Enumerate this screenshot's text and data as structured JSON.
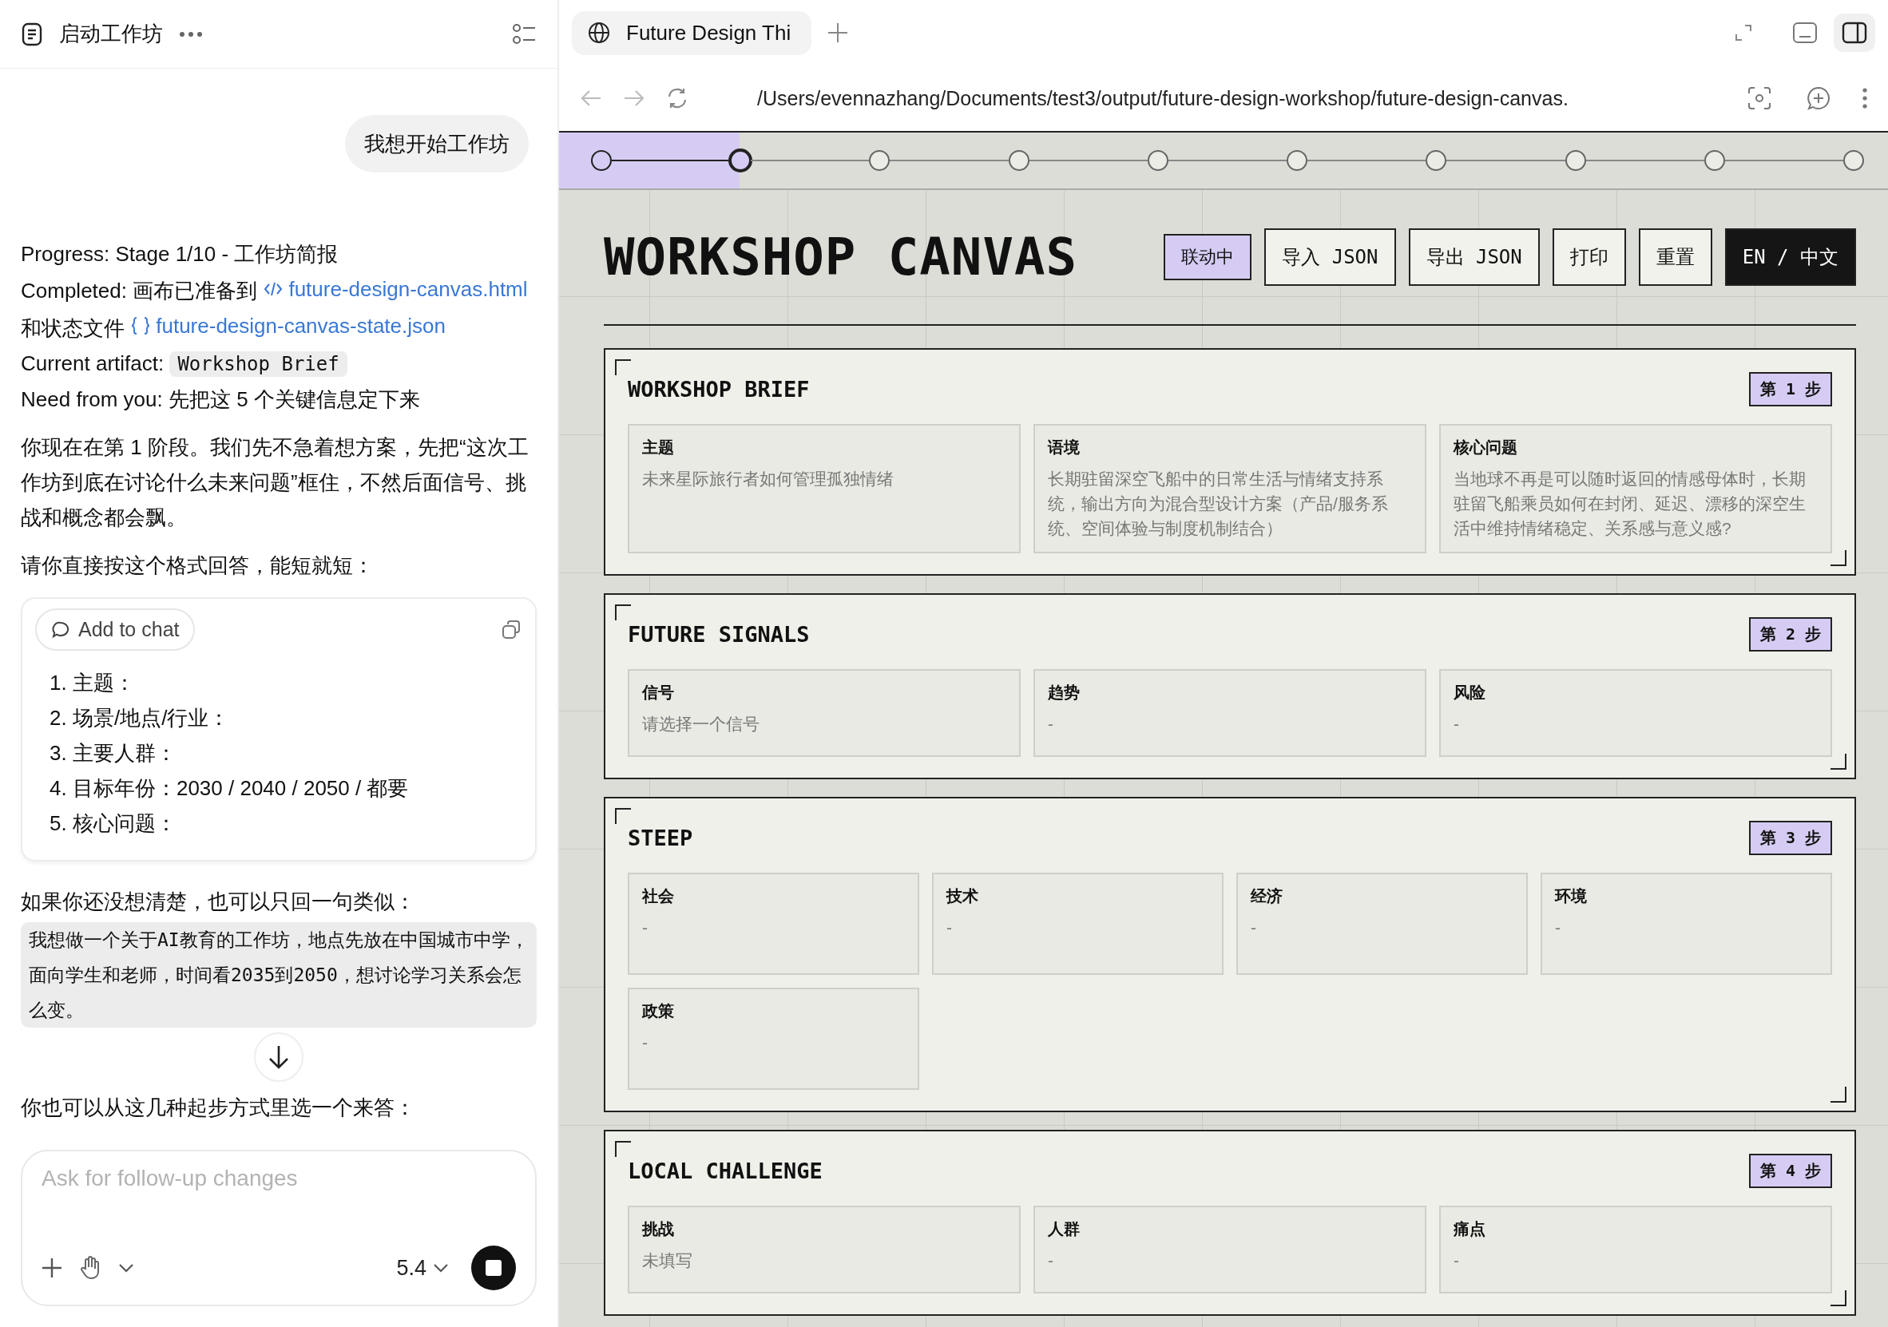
{
  "chat": {
    "title": "启动工作坊",
    "user_message": "我想开始工作坊",
    "status_lines": [
      [
        {
          "kind": "text",
          "text": "Progress: Stage 1/10 - 工作坊简报"
        }
      ],
      [
        {
          "kind": "text",
          "text": "Completed: 画布已准备到 "
        },
        {
          "kind": "link",
          "text": "future-design-canvas.html"
        },
        {
          "kind": "text",
          "text": " 和状态文件 "
        },
        {
          "kind": "link",
          "text": "future-design-canvas-state.json"
        }
      ],
      [
        {
          "kind": "text",
          "text": "Current artifact: "
        },
        {
          "kind": "code",
          "text": "Workshop Brief"
        }
      ],
      [
        {
          "kind": "text",
          "text": "Need from you: 先把这 5 个关键信息定下来"
        }
      ]
    ],
    "paragraphs": [
      "你现在在第 1 阶段。我们先不急着想方案，先把“这次工作坊到底在讨论什么未来问题”框住，不然后面信号、挑战和概念都会飘。",
      "请你直接按这个格式回答，能短就短："
    ],
    "template_card": {
      "action": "Add to chat",
      "items": [
        {
          "number": "1.",
          "text": "主题："
        },
        {
          "number": "2.",
          "text": "场景/地点/行业："
        },
        {
          "number": "3.",
          "text": "主要人群："
        },
        {
          "number": "4.",
          "text": "目标年份：2030 / 2040 / 2050 / 都要"
        },
        {
          "number": "5.",
          "text": "核心问题："
        }
      ]
    },
    "hint": "如果你还没想清楚，也可以只回一句类似：",
    "example": "我想做一个关于AI教育的工作坊，地点先放在中国城市中学，面向学生和老师，时间看2035到2050，想讨论学习关系会怎么变。",
    "cut_line": "你也可以从这几种起步方式里选一个来答：",
    "composer": {
      "placeholder": "Ask for follow-up changes",
      "model": "5.4"
    }
  },
  "browser": {
    "tab_title": "Future Design Thi",
    "url": "/Users/evennazhang/Documents/test3/output/future-design-workshop/future-design-canvas."
  },
  "canvas": {
    "title": "WORKSHOP CANVAS",
    "steps": [
      {
        "done": true,
        "selected": false
      },
      {
        "done": false,
        "selected": true
      },
      {
        "done": false,
        "selected": false
      },
      {
        "done": false,
        "selected": false
      },
      {
        "done": false,
        "selected": false
      },
      {
        "done": false,
        "selected": false
      },
      {
        "done": false,
        "selected": false
      },
      {
        "done": false,
        "selected": false
      },
      {
        "done": false,
        "selected": false
      },
      {
        "done": false,
        "selected": false
      }
    ],
    "buttons": [
      {
        "kind": "status",
        "label": "联动中"
      },
      {
        "kind": "normal",
        "label": "导入 JSON"
      },
      {
        "kind": "normal",
        "label": "导出 JSON"
      },
      {
        "kind": "normal",
        "label": "打印"
      },
      {
        "kind": "normal",
        "label": "重置"
      },
      {
        "kind": "dark",
        "label": "EN / 中文"
      }
    ],
    "sections": [
      {
        "title": "WORKSHOP BRIEF",
        "step": "第 1 步",
        "fields": [
          {
            "label": "主题",
            "value": "未来星际旅行者如何管理孤独情绪"
          },
          {
            "label": "语境",
            "value": "长期驻留深空飞船中的日常生活与情绪支持系统，输出方向为混合型设计方案（产品/服务系统、空间体验与制度机制结合）"
          },
          {
            "label": "核心问题",
            "value": "当地球不再是可以随时返回的情感母体时，长期驻留飞船乘员如何在封闭、延迟、漂移的深空生活中维持情绪稳定、关系感与意义感?"
          }
        ]
      },
      {
        "title": "FUTURE SIGNALS",
        "step": "第 2 步",
        "fields": [
          {
            "label": "信号",
            "value": "请选择一个信号"
          },
          {
            "label": "趋势",
            "value": "-"
          },
          {
            "label": "风险",
            "value": "-"
          }
        ]
      },
      {
        "title": "STEEP",
        "step": "第 3 步",
        "fields": [
          {
            "label": "社会",
            "value": "-"
          },
          {
            "label": "技术",
            "value": "-"
          },
          {
            "label": "经济",
            "value": "-"
          },
          {
            "label": "环境",
            "value": "-"
          },
          {
            "label": "政策",
            "value": "-"
          }
        ]
      },
      {
        "title": "LOCAL CHALLENGE",
        "step": "第 4 步",
        "fields": [
          {
            "label": "挑战",
            "value": "未填写"
          },
          {
            "label": "人群",
            "value": "-"
          },
          {
            "label": "痛点",
            "value": "-"
          }
        ]
      }
    ]
  }
}
